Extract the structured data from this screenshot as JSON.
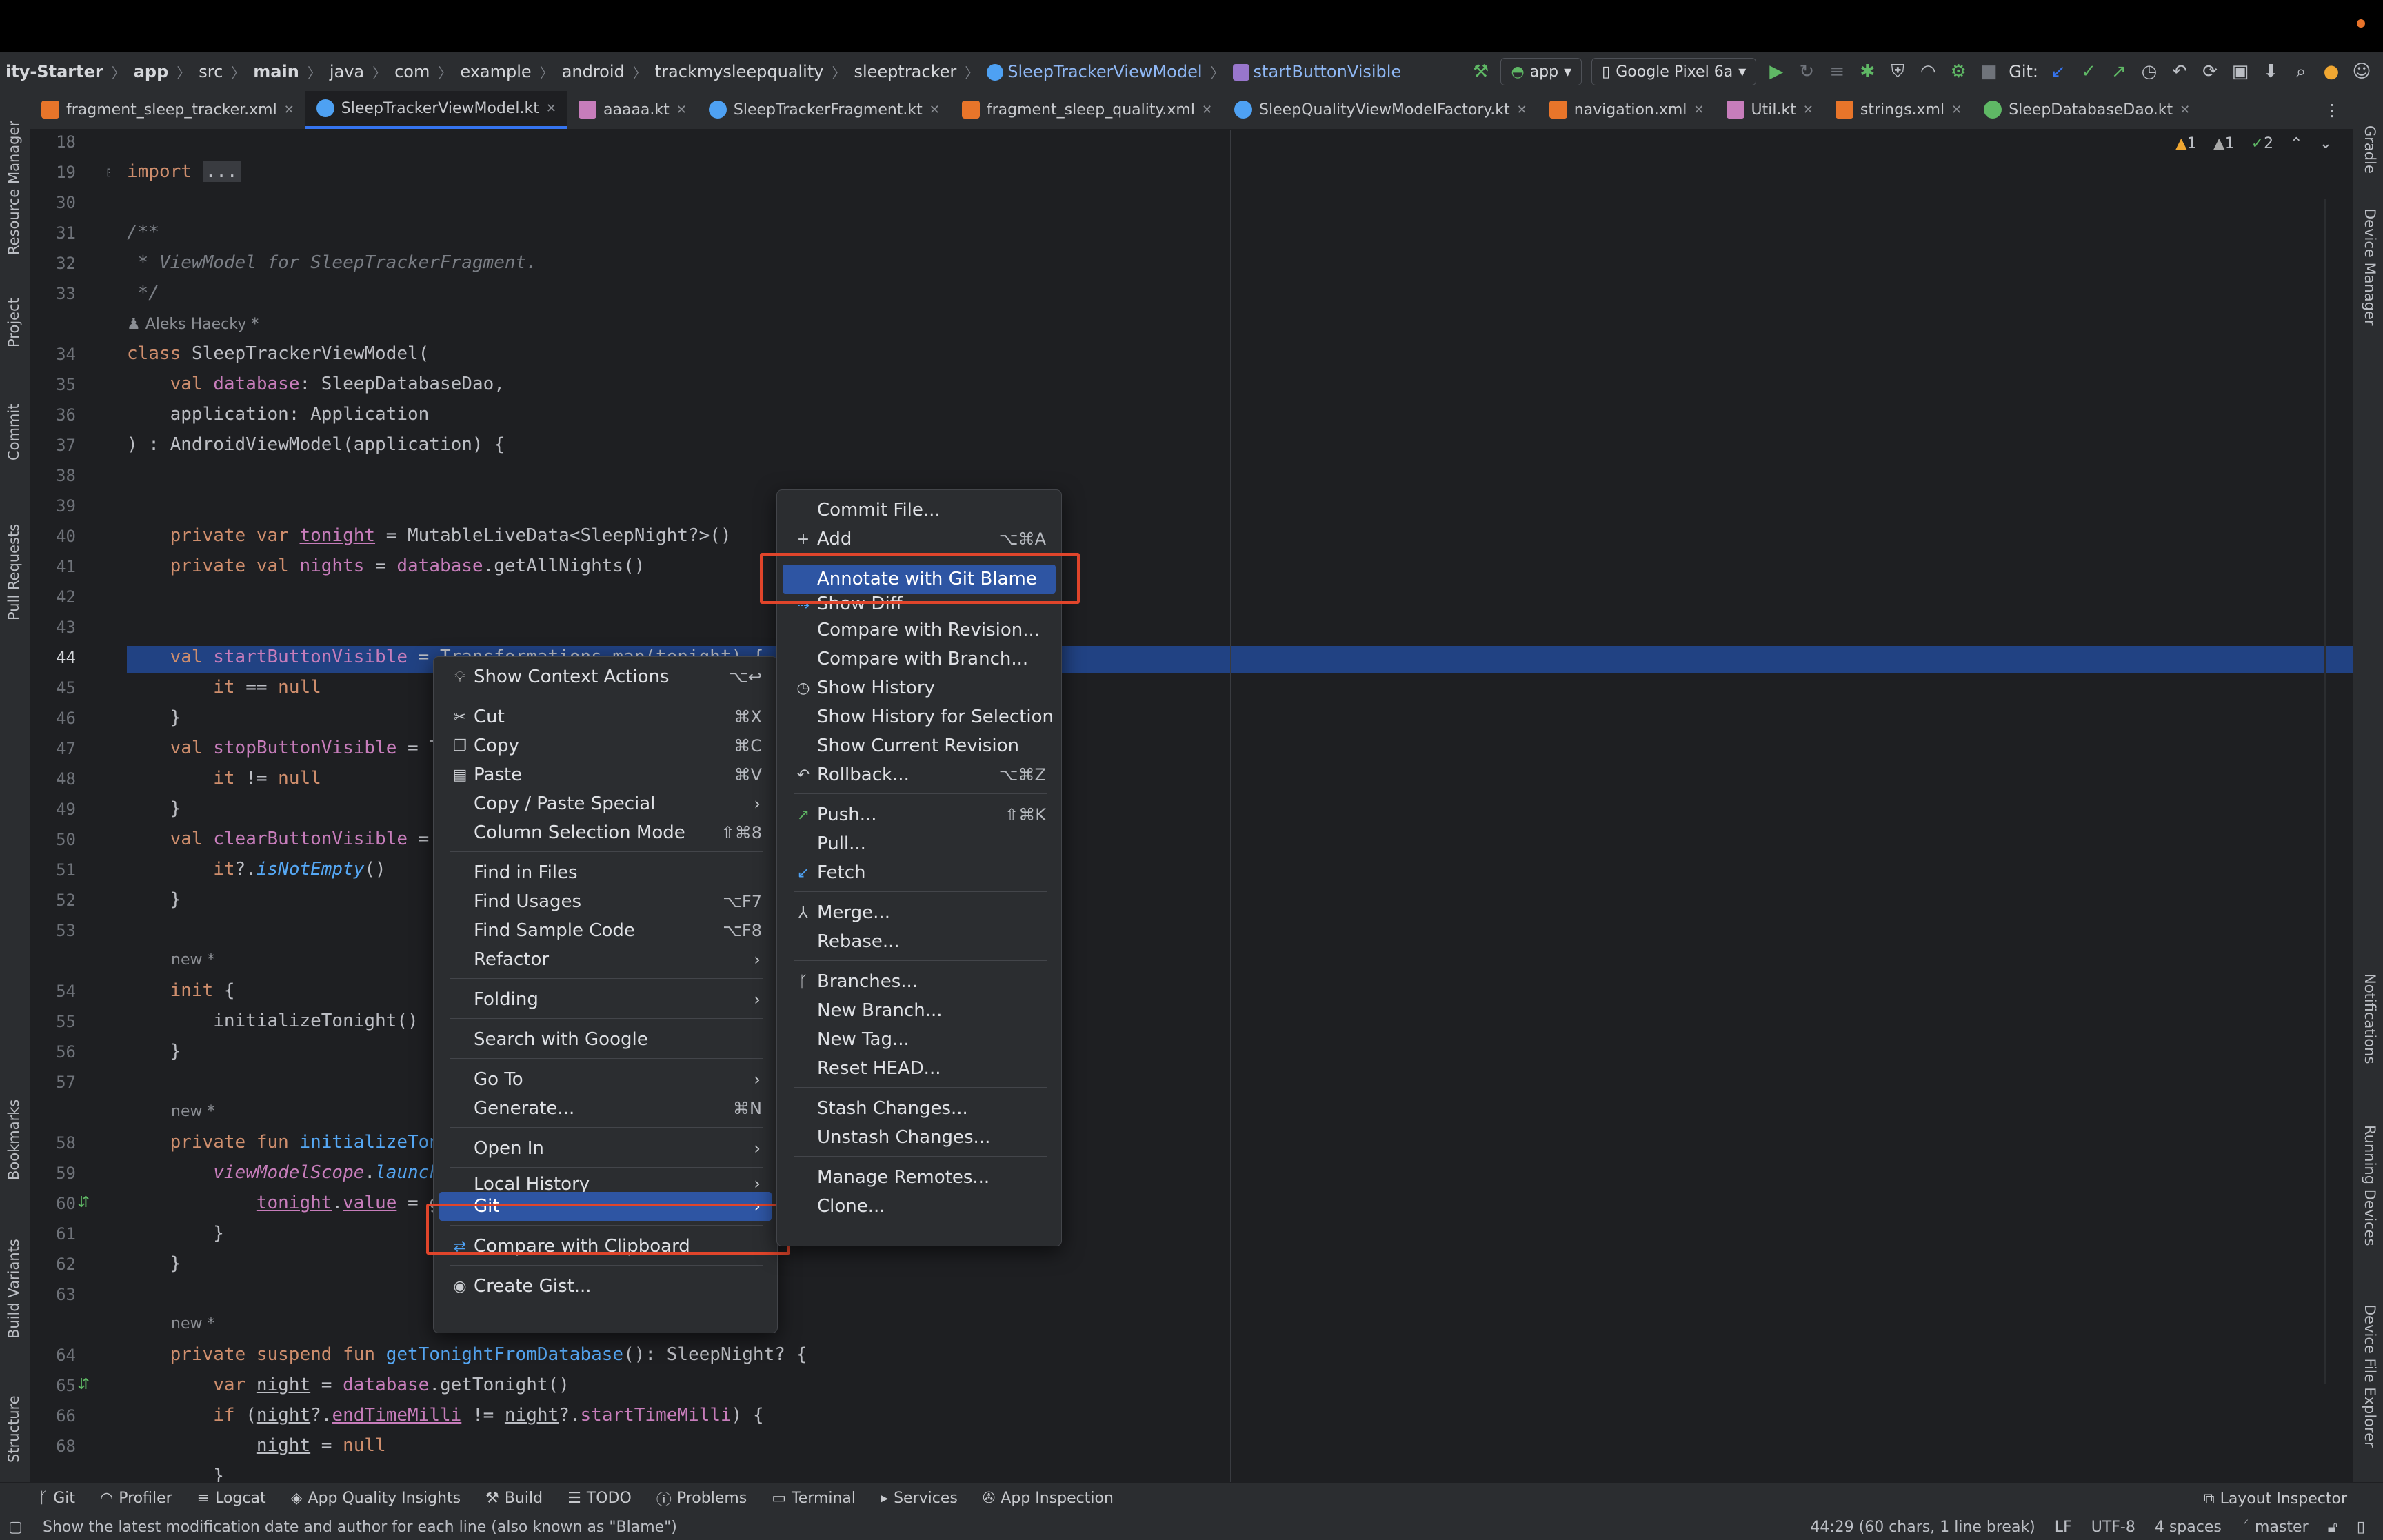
{
  "breadcrumbs": [
    "ity-Starter",
    "app",
    "src",
    "main",
    "java",
    "com",
    "example",
    "android",
    "trackmysleepquality",
    "sleeptracker",
    "SleepTrackerViewModel",
    "startButtonVisible"
  ],
  "toolbar": {
    "config": "app",
    "device": "Google Pixel 6a",
    "git_label": "Git:"
  },
  "tabs": [
    {
      "label": "fragment_sleep_tracker.xml",
      "color": "#e8752a"
    },
    {
      "label": "SleepTrackerViewModel.kt",
      "color": "#4ea1f3",
      "active": true
    },
    {
      "label": "aaaaa.kt",
      "color": "#c77dbb"
    },
    {
      "label": "SleepTrackerFragment.kt",
      "color": "#4ea1f3"
    },
    {
      "label": "fragment_sleep_quality.xml",
      "color": "#e8752a"
    },
    {
      "label": "SleepQualityViewModelFactory.kt",
      "color": "#4ea1f3"
    },
    {
      "label": "navigation.xml",
      "color": "#e8752a"
    },
    {
      "label": "Util.kt",
      "color": "#c77dbb"
    },
    {
      "label": "strings.xml",
      "color": "#e8752a"
    },
    {
      "label": "SleepDatabaseDao.kt",
      "color": "#5fb865"
    }
  ],
  "left_tools": [
    "Resource Manager",
    "Project",
    "Commit",
    "Pull Requests",
    "Bookmarks",
    "Build Variants",
    "Structure"
  ],
  "right_tools": [
    "Gradle",
    "Device Manager",
    "Notifications",
    "Running Devices",
    "Device File Explorer"
  ],
  "warnings": {
    "warn": "1",
    "weak": "1",
    "ok": "2"
  },
  "line_numbers": [
    "18",
    "19",
    "30",
    "31",
    "32",
    "33",
    "34",
    "35",
    "36",
    "37",
    "38",
    "39",
    "40",
    "41",
    "42",
    "43",
    "44",
    "45",
    "46",
    "47",
    "48",
    "49",
    "50",
    "51",
    "52",
    "53",
    "54",
    "55",
    "56",
    "57",
    "58",
    "59",
    "60",
    "61",
    "62",
    "63",
    "64",
    "65",
    "66",
    "68"
  ],
  "code": {
    "import_kw": "import",
    "import_dots": "...",
    "doc_open": "/**",
    "doc_text": " * ViewModel for SleepTrackerFragment.",
    "doc_close": " */",
    "author": "Aleks Haecky *",
    "new_marker": "new *"
  },
  "context_menu": {
    "items": [
      {
        "label": "Show Context Actions",
        "shortcut": "⌥↩",
        "icon": "bulb-icon"
      },
      {
        "label": "Cut",
        "shortcut": "⌘X",
        "icon": "scissors-icon"
      },
      {
        "label": "Copy",
        "shortcut": "⌘C",
        "icon": "copy-icon"
      },
      {
        "label": "Paste",
        "shortcut": "⌘V",
        "icon": "clipboard-icon"
      },
      {
        "label": "Copy / Paste Special"
      },
      {
        "label": "Column Selection Mode",
        "shortcut": "⇧⌘8"
      },
      {
        "label": "Find in Files"
      },
      {
        "label": "Find Usages",
        "shortcut": "⌥F7"
      },
      {
        "label": "Find Sample Code",
        "shortcut": "⌥F8"
      },
      {
        "label": "Refactor"
      },
      {
        "label": "Folding"
      },
      {
        "label": "Search with Google"
      },
      {
        "label": "Go To"
      },
      {
        "label": "Generate...",
        "shortcut": "⌘N"
      },
      {
        "label": "Open In"
      },
      {
        "label": "Local History"
      },
      {
        "label": "Git"
      },
      {
        "label": "Compare with Clipboard",
        "icon": "compare-icon"
      },
      {
        "label": "Create Gist...",
        "icon": "github-icon"
      }
    ]
  },
  "git_menu": {
    "items": [
      {
        "label": "Commit File..."
      },
      {
        "label": "Add",
        "shortcut": "⌥⌘A",
        "icon": "plus-icon"
      },
      {
        "label": "Annotate with Git Blame"
      },
      {
        "label": "Show Diff",
        "icon": "diff-icon"
      },
      {
        "label": "Compare with Revision..."
      },
      {
        "label": "Compare with Branch..."
      },
      {
        "label": "Show History",
        "icon": "clock-icon"
      },
      {
        "label": "Show History for Selection"
      },
      {
        "label": "Show Current Revision"
      },
      {
        "label": "Rollback...",
        "shortcut": "⌥⌘Z",
        "icon": "undo-icon"
      },
      {
        "label": "Push...",
        "shortcut": "⇧⌘K",
        "icon": "push-icon"
      },
      {
        "label": "Pull..."
      },
      {
        "label": "Fetch",
        "icon": "fetch-icon"
      },
      {
        "label": "Merge...",
        "icon": "merge-icon"
      },
      {
        "label": "Rebase..."
      },
      {
        "label": "Branches...",
        "icon": "branch-icon"
      },
      {
        "label": "New Branch..."
      },
      {
        "label": "New Tag..."
      },
      {
        "label": "Reset HEAD..."
      },
      {
        "label": "Stash Changes..."
      },
      {
        "label": "Unstash Changes..."
      },
      {
        "label": "Manage Remotes..."
      },
      {
        "label": "Clone..."
      }
    ]
  },
  "tool_windows": [
    "Git",
    "Profiler",
    "Logcat",
    "App Quality Insights",
    "Build",
    "TODO",
    "Problems",
    "Terminal",
    "Services",
    "App Inspection"
  ],
  "layout_inspector": "Layout Inspector",
  "status": {
    "message": "Show the latest modification date and author for each line (also known as \"Blame\")",
    "position": "44:29 (60 chars, 1 line break)",
    "line_sep": "LF",
    "encoding": "UTF-8",
    "indent": "4 spaces",
    "branch": "master"
  },
  "colors": {
    "accent": "#3574f0",
    "selection": "#2e55a3",
    "highlight": "#e0452b"
  }
}
